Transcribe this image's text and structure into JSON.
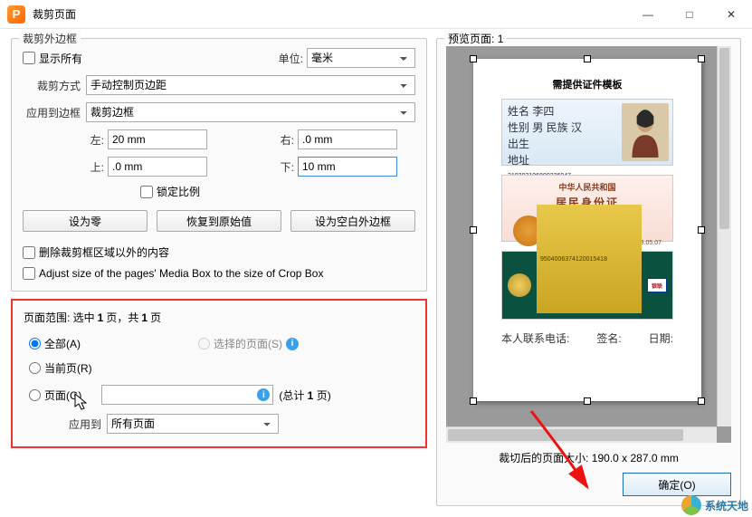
{
  "window": {
    "title": "裁剪页面"
  },
  "winbtns": {
    "min": "—",
    "max": "□",
    "close": "✕"
  },
  "group_crop": {
    "legend": "裁剪外边框",
    "show_all": "显示所有",
    "unit_label": "单位:",
    "unit_value": "毫米",
    "crop_mode_label": "裁剪方式",
    "crop_mode_value": "手动控制页边距",
    "apply_border_label": "应用到边框",
    "apply_border_value": "裁剪边框",
    "left_label": "左:",
    "left_value": "20 mm",
    "right_label": "右:",
    "right_value": ".0 mm",
    "top_label": "上:",
    "top_value": ".0 mm",
    "bottom_label": "下:",
    "bottom_value": "10 mm",
    "lock_ratio": "锁定比例",
    "btn_zero": "设为零",
    "btn_restore": "恢复到原始值",
    "btn_blank": "设为空白外边框",
    "remove_outside": "删除裁剪框区域以外的内容",
    "adjust_media": "Adjust size of the pages' Media Box to the size of Crop Box"
  },
  "page_range": {
    "heading_prefix": "页面范围: 选中",
    "heading_bold1": "1",
    "heading_mid": "页，共",
    "heading_bold2": "1",
    "heading_suffix": "页",
    "radio_all": "全部(A)",
    "radio_selected": "选择的页面(S)",
    "radio_current": "当前页(R)",
    "radio_pages": "页面(G)",
    "total_prefix": "(总计",
    "total_bold": "1",
    "total_suffix": "页)",
    "apply_to_label": "应用到",
    "apply_to_value": "所有页面"
  },
  "preview": {
    "legend_prefix": "预览页面:",
    "legend_num": "1",
    "doc_title": "需提供证件模板",
    "card1_lines": {
      "l1": "姓名 李四",
      "l2": "性别 男  民族 汉",
      "l3": "出生",
      "l4": "地址"
    },
    "card1_id": "210203196809236047",
    "card2_t1": "中华人民共和国",
    "card2_t2": "居民身份证",
    "card2_date": "2008.04.10-2018.05.07",
    "card3_strip": "9504006374120015418",
    "card3_up": "银联",
    "footer": {
      "f1": "本人联系电话:",
      "f2": "签名:",
      "f3": "日期:"
    },
    "page_tab": "1",
    "size_info": "裁切后的页面大小: 190.0 x 287.0 mm"
  },
  "ok_button": "确定(O)",
  "watermark": "系统天地",
  "app_icon_letter": "P",
  "info_glyph": "i"
}
